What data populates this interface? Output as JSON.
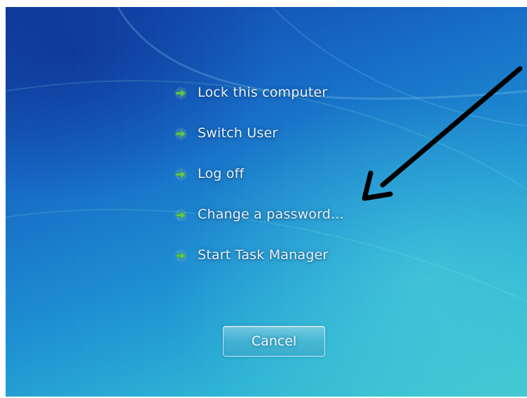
{
  "menu": {
    "items": [
      {
        "label": "Lock this computer",
        "icon": "green-arrow-icon"
      },
      {
        "label": "Switch User",
        "icon": "green-arrow-icon"
      },
      {
        "label": "Log off",
        "icon": "green-arrow-icon"
      },
      {
        "label": "Change a password...",
        "icon": "green-arrow-icon"
      },
      {
        "label": "Start Task Manager",
        "icon": "green-arrow-icon"
      }
    ]
  },
  "cancel": {
    "label": "Cancel"
  },
  "colors": {
    "background_top": "#0e3fa3",
    "background_bottom": "#3fc6cf",
    "text": "#e6f2fb",
    "arrow_icon": "#5cc65a",
    "annotation_arrow": "#000000"
  }
}
